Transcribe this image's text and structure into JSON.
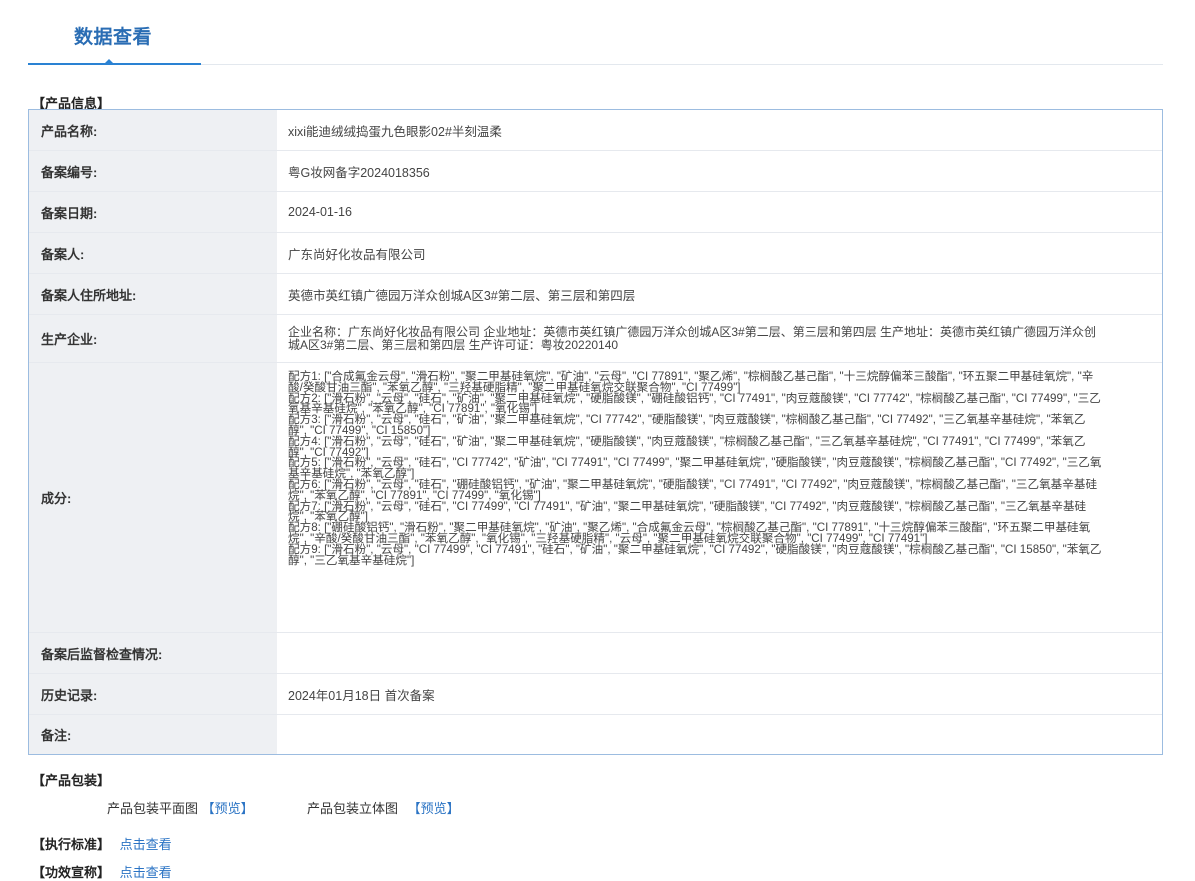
{
  "tab": {
    "label": "数据查看"
  },
  "product_info": {
    "title": "【产品信息】",
    "rows": [
      {
        "key": "产品名称:",
        "value": "xixi能迪绒绒捣蛋九色眼影02#半刻温柔"
      },
      {
        "key": "备案编号:",
        "value": "粤G妆网备字2024018356"
      },
      {
        "key": "备案日期:",
        "value": "2024-01-16"
      },
      {
        "key": "备案人:",
        "value": "广东尚好化妆品有限公司"
      },
      {
        "key": "备案人住所地址:",
        "value": "英德市英红镇广德园万洋众创城A区3#第二层、第三层和第四层"
      },
      {
        "key": "生产企业:",
        "value": "企业名称：广东尚好化妆品有限公司 企业地址：英德市英红镇广德园万洋众创城A区3#第二层、第三层和第四层 生产地址：英德市英红镇广德园万洋众创城A区3#第二层、第三层和第四层 生产许可证：粤妆20220140"
      }
    ],
    "ingredients_key": "成分:",
    "formulas": [
      "配方1: [\"合成氟金云母\", \"滑石粉\", \"聚二甲基硅氧烷\", \"矿油\", \"云母\", \"CI 77891\", \"聚乙烯\", \"棕榈酸乙基己酯\", \"十三烷醇偏苯三酸酯\", \"环五聚二甲基硅氧烷\", \"辛酸/癸酸甘油三酯\", \"苯氧乙醇\", \"三羟基硬脂精\", \"聚二甲基硅氧烷交联聚合物\", \"CI 77499\"]",
      "配方2: [\"滑石粉\", \"云母\", \"硅石\", \"矿油\", \"聚二甲基硅氧烷\", \"硬脂酸镁\", \"硼硅酸铝钙\", \"CI 77491\", \"肉豆蔻酸镁\", \"CI 77742\", \"棕榈酸乙基己酯\", \"CI 77499\", \"三乙氧基辛基硅烷\", \"苯氧乙醇\", \"CI 77891\", \"氧化锡\"]",
      "配方3: [\"滑石粉\", \"云母\", \"硅石\", \"矿油\", \"聚二甲基硅氧烷\", \"CI 77742\", \"硬脂酸镁\", \"肉豆蔻酸镁\", \"棕榈酸乙基己酯\", \"CI 77492\", \"三乙氧基辛基硅烷\", \"苯氧乙醇\", \"CI 77499\", \"CI 15850\"]",
      "配方4: [\"滑石粉\", \"云母\", \"硅石\", \"矿油\", \"聚二甲基硅氧烷\", \"硬脂酸镁\", \"肉豆蔻酸镁\", \"棕榈酸乙基己酯\", \"三乙氧基辛基硅烷\", \"CI 77491\", \"CI 77499\", \"苯氧乙醇\", \"CI 77492\"]",
      "配方5: [\"滑石粉\", \"云母\", \"硅石\", \"CI 77742\", \"矿油\", \"CI 77491\", \"CI 77499\", \"聚二甲基硅氧烷\", \"硬脂酸镁\", \"肉豆蔻酸镁\", \"棕榈酸乙基己酯\", \"CI 77492\", \"三乙氧基辛基硅烷\", \"苯氧乙醇\"]",
      "配方6: [\"滑石粉\", \"云母\", \"硅石\", \"硼硅酸铝钙\", \"矿油\", \"聚二甲基硅氧烷\", \"硬脂酸镁\", \"CI 77491\", \"CI 77492\", \"肉豆蔻酸镁\", \"棕榈酸乙基己酯\", \"三乙氧基辛基硅烷\", \"苯氧乙醇\", \"CI 77891\", \"CI 77499\", \"氧化锡\"]",
      "配方7: [\"滑石粉\", \"云母\", \"硅石\", \"CI 77499\", \"CI 77491\", \"矿油\", \"聚二甲基硅氧烷\", \"硬脂酸镁\", \"CI 77492\", \"肉豆蔻酸镁\", \"棕榈酸乙基己酯\", \"三乙氧基辛基硅烷\", \"苯氧乙醇\"]",
      "配方8: [\"硼硅酸铝钙\", \"滑石粉\", \"聚二甲基硅氧烷\", \"矿油\", \"聚乙烯\", \"合成氟金云母\", \"棕榈酸乙基己酯\", \"CI 77891\", \"十三烷醇偏苯三酸酯\", \"环五聚二甲基硅氧烷\", \"辛酸/癸酸甘油三酯\", \"苯氧乙醇\", \"氧化锡\", \"三羟基硬脂精\", \"云母\", \"聚二甲基硅氧烷交联聚合物\", \"CI 77499\", \"CI 77491\"]",
      "配方9: [\"滑石粉\", \"云母\", \"CI 77499\", \"CI 77491\", \"硅石\", \"矿油\", \"聚二甲基硅氧烷\", \"CI 77492\", \"硬脂酸镁\", \"肉豆蔻酸镁\", \"棕榈酸乙基己酯\", \"CI 15850\", \"苯氧乙醇\", \"三乙氧基辛基硅烷\"]"
    ],
    "bottom_rows": [
      {
        "key": "备案后监督检查情况:",
        "value": ""
      },
      {
        "key": "历史记录:",
        "value": "2024年01月18日 首次备案"
      },
      {
        "key": "备注:",
        "value": ""
      }
    ]
  },
  "packaging": {
    "title": "【产品包装】",
    "flat_label": "产品包装平面图",
    "solid_label": "产品包装立体图",
    "preview_link": "【预览】"
  },
  "standard": {
    "title": "【执行标准】",
    "link": "点击查看"
  },
  "efficacy": {
    "title": "【功效宣称】",
    "link": "点击查看"
  }
}
